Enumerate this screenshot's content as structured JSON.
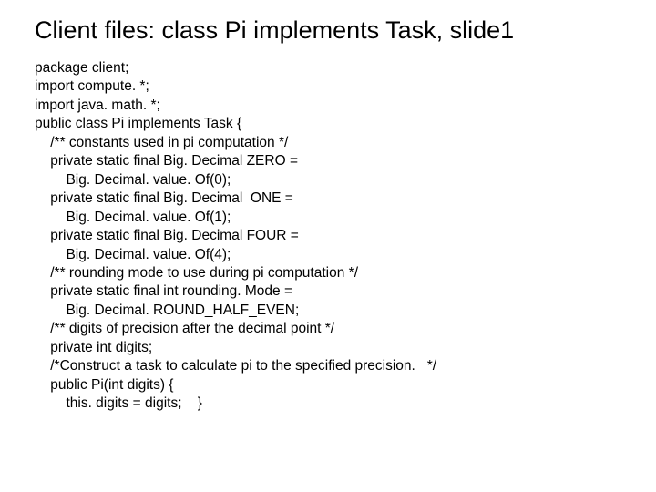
{
  "title": "Client files: class Pi implements Task, slide1",
  "lines": [
    "package client;",
    "import compute. *;",
    "import java. math. *;",
    "public class Pi implements Task {",
    "    /** constants used in pi computation */",
    "    private static final Big. Decimal ZERO =",
    "        Big. Decimal. value. Of(0);",
    "    private static final Big. Decimal  ONE =",
    "        Big. Decimal. value. Of(1);",
    "    private static final Big. Decimal FOUR =",
    "        Big. Decimal. value. Of(4);",
    "    /** rounding mode to use during pi computation */",
    "    private static final int rounding. Mode =",
    "        Big. Decimal. ROUND_HALF_EVEN;",
    "    /** digits of precision after the decimal point */",
    "    private int digits;",
    "    /*Construct a task to calculate pi to the specified precision.   */",
    "    public Pi(int digits) {",
    "        this. digits = digits;    }"
  ]
}
